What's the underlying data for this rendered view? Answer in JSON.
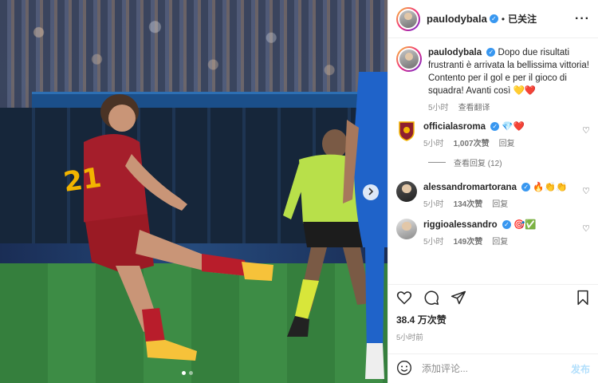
{
  "header": {
    "username": "paulodybala",
    "separator": "•",
    "follow_state": "已关注",
    "more": "···"
  },
  "caption": {
    "username": "paulodybala",
    "text": "Dopo due risultati frustranti è arrivata la bellissima vittoria! Contento per il gol e per il gioco di squadra! Avanti così 💛❤️",
    "time": "5小时",
    "translate": "查看翻译"
  },
  "comments": [
    {
      "username": "officialasroma",
      "text": "💎❤️",
      "time": "5小时",
      "likes": "1,007次赞",
      "reply": "回复"
    },
    {
      "username": "alessandromartorana",
      "text": "🔥👏👏",
      "time": "5小时",
      "likes": "134次赞",
      "reply": "回复"
    },
    {
      "username": "riggioalessandro",
      "text": "🎯✅",
      "time": "5小时",
      "likes": "149次赞",
      "reply": "回复"
    }
  ],
  "view_replies": "查看回复 (12)",
  "post": {
    "likes": "38.4 万次赞",
    "time": "5小时前"
  },
  "add_comment": {
    "placeholder": "添加评论...",
    "post_button": "发布"
  },
  "colors": {
    "verified": "#3897f0",
    "post_button_disabled": "#b2dffc",
    "roma_red": "#8e1f2f",
    "referee_green": "#b8e04a"
  },
  "icons": [
    "heart-icon",
    "comment-icon",
    "share-icon",
    "bookmark-icon",
    "emoji-icon",
    "chevron-right-icon",
    "more-icon"
  ]
}
